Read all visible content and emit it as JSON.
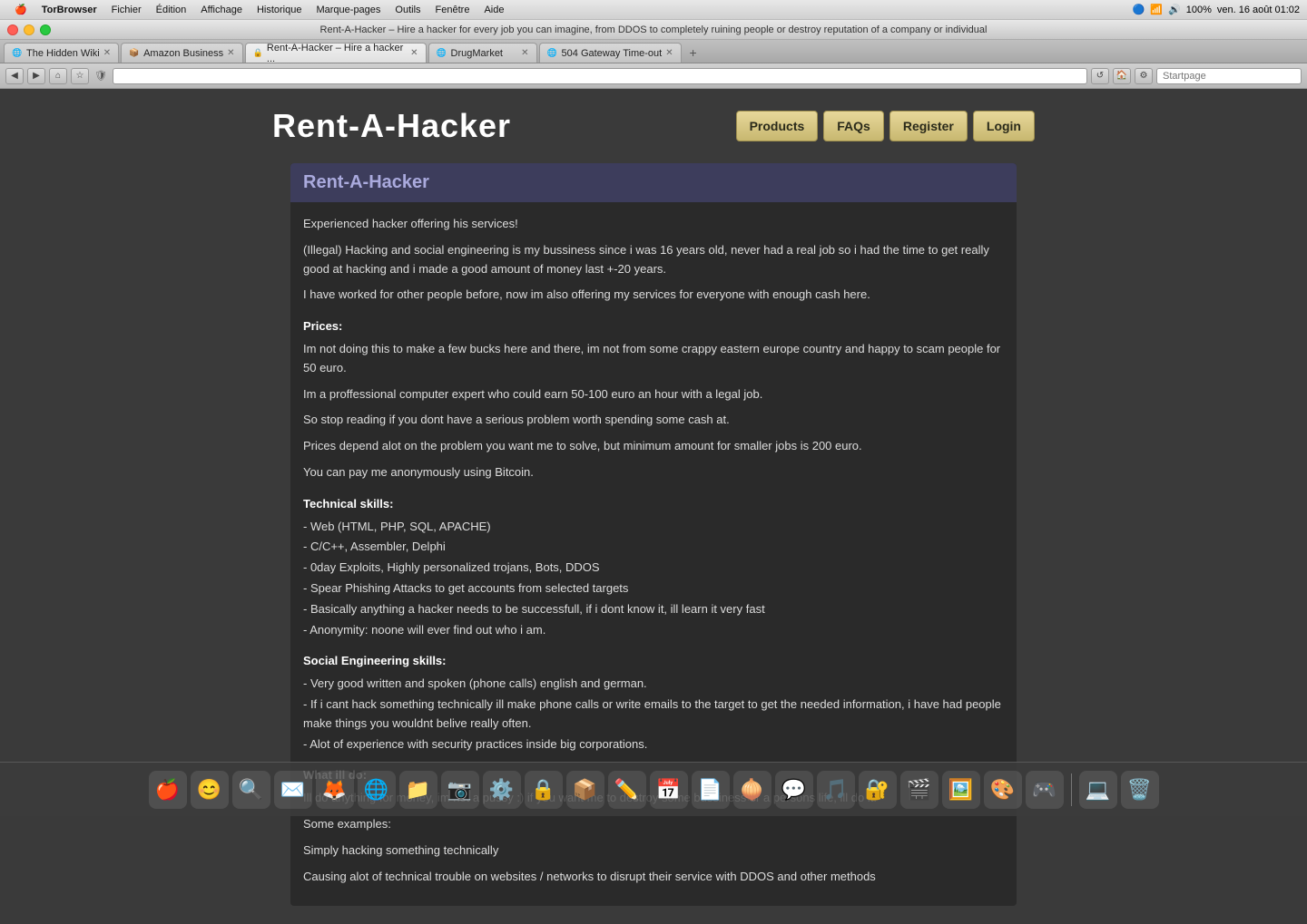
{
  "os": {
    "apple_label": "",
    "menu_items": [
      "TorBrowser",
      "Fichier",
      "Édition",
      "Affichage",
      "Historique",
      "Marque-pages",
      "Outils",
      "Fenêtre",
      "Aide"
    ],
    "status_right": "ven. 16 août  01:02",
    "battery": "100%",
    "wifi": "WiFi"
  },
  "browser": {
    "title": "Rent-A-Hacker – Hire a hacker for every job you can imagine, from DDOS to completely ruining people or destroy reputation of a company or individual",
    "url": "",
    "search_placeholder": "Startpage",
    "tabs": [
      {
        "label": "The Hidden Wiki",
        "active": false,
        "favicon": "🌐"
      },
      {
        "label": "Amazon Business",
        "active": false,
        "favicon": "📦"
      },
      {
        "label": "Rent-A-Hacker – Hire a hacker ...",
        "active": true,
        "favicon": "🔒"
      },
      {
        "label": "DrugMarket",
        "active": false,
        "favicon": "🌐"
      },
      {
        "label": "504 Gateway Time-out",
        "active": false,
        "favicon": "🌐"
      }
    ]
  },
  "site": {
    "title": "Rent-A-Hacker",
    "nav": {
      "products": "Products",
      "faqs": "FAQs",
      "register": "Register",
      "login": "Login"
    },
    "page_heading": "Rent-A-Hacker",
    "intro": [
      "Experienced hacker offering his services!",
      "(Illegal) Hacking and social engineering is my bussiness since i was 16 years old, never had a real job so i had the time to get really good at hacking and i made a good amount of money last +-20 years.",
      "I have worked for other people before, now im also offering my services for everyone with enough cash here."
    ],
    "prices_title": "Prices:",
    "prices_lines": [
      "Im not doing this to make a few bucks here and there, im not from some crappy eastern europe country and happy to scam people for 50 euro.",
      "Im a proffessional computer expert who could earn 50-100 euro an hour with a legal job.",
      "So stop reading if you dont have a serious problem worth spending some cash at.",
      "Prices depend alot on the problem you want me to solve, but minimum amount for smaller jobs is 200 euro.",
      "You can pay me anonymously using Bitcoin."
    ],
    "tech_skills_title": "Technical skills:",
    "tech_skills": [
      "- Web (HTML, PHP, SQL, APACHE)",
      "- C/C++, Assembler, Delphi",
      "- 0day Exploits, Highly personalized trojans, Bots, DDOS",
      "- Spear Phishing Attacks to get accounts from selected targets",
      "- Basically anything a hacker needs to be successfull, if i dont know it, ill learn it very fast",
      "- Anonymity: noone will ever find out who i am."
    ],
    "social_title": "Social Engineering skills:",
    "social_skills": [
      "- Very good written and spoken (phone calls) english and german.",
      "- If i cant hack something technically ill make phone calls or write emails to the target to get the needed information, i have had people make things you wouldnt belive really often.",
      "- Alot of experience with security practices inside big corporations."
    ],
    "what_title": "What ill do:",
    "what_lines": [
      "Ill do anything for money, im not a pussy :) if you want me to destroy some bussiness or a persons life, ill do it!",
      "Some examples:",
      "Simply hacking something technically",
      "Causing alot of technical trouble on websites / networks to disrupt their service with DDOS and other methods"
    ]
  },
  "dock": {
    "icons": [
      "🍎",
      "📁",
      "🔍",
      "📧",
      "🌐",
      "🎵",
      "📷",
      "📹",
      "🗒️",
      "⚙️",
      "🔒",
      "📦",
      "🖊️",
      "📚",
      "📊",
      "🎯",
      "🖼️",
      "🎮",
      "🔧",
      "💻",
      "📱",
      "🗑️"
    ]
  }
}
